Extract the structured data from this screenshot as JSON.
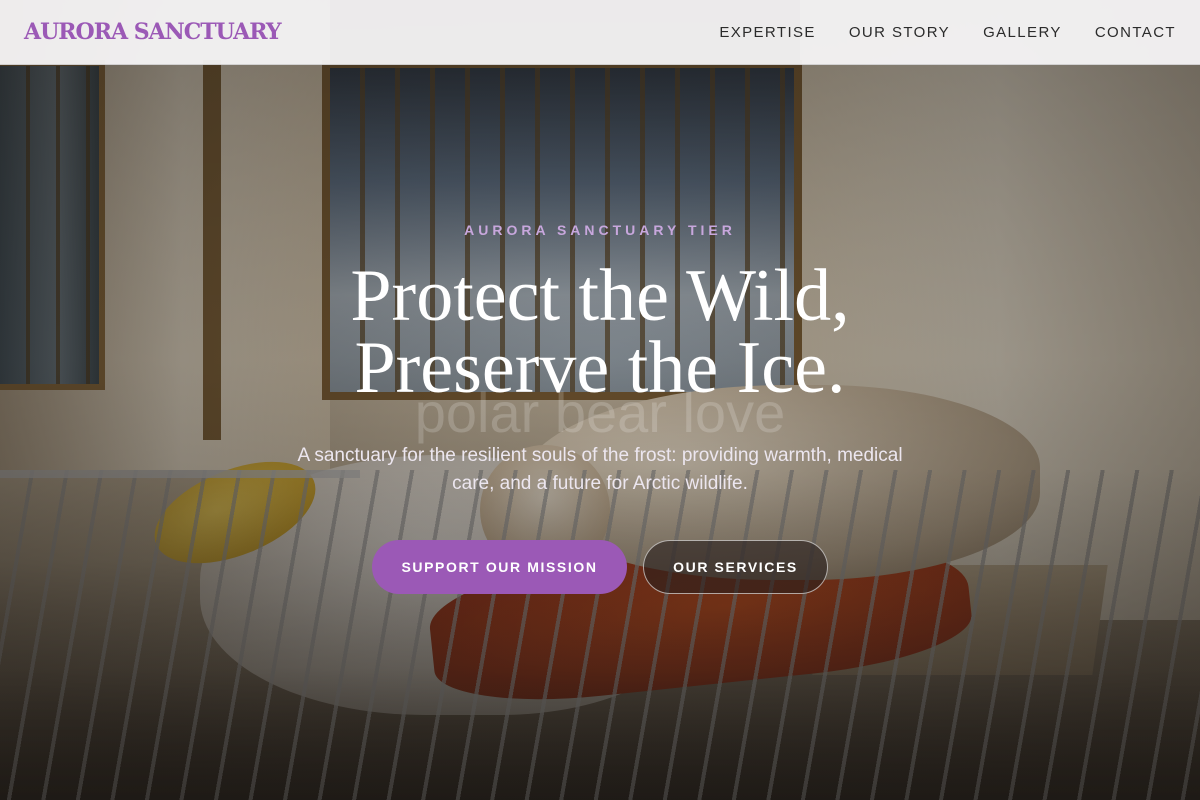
{
  "header": {
    "brand": "AURORA SANCTUARY",
    "nav": [
      {
        "label": "EXPERTISE"
      },
      {
        "label": "OUR STORY"
      },
      {
        "label": "GALLERY"
      },
      {
        "label": "CONTACT"
      }
    ]
  },
  "hero": {
    "eyebrow": "AURORA SANCTUARY TIER",
    "headline_line1": "Protect the Wild,",
    "headline_line2": "Preserve the Ice.",
    "watermark": "polar bear love",
    "subtitle": "A sanctuary for the resilient souls of the frost: providing warmth, medical care, and a future for Arctic wildlife.",
    "primary_cta": "SUPPORT OUR MISSION",
    "secondary_cta": "OUR SERVICES"
  },
  "colors": {
    "accent": "#9b59b6",
    "eyebrow": "#c8a7dd"
  }
}
